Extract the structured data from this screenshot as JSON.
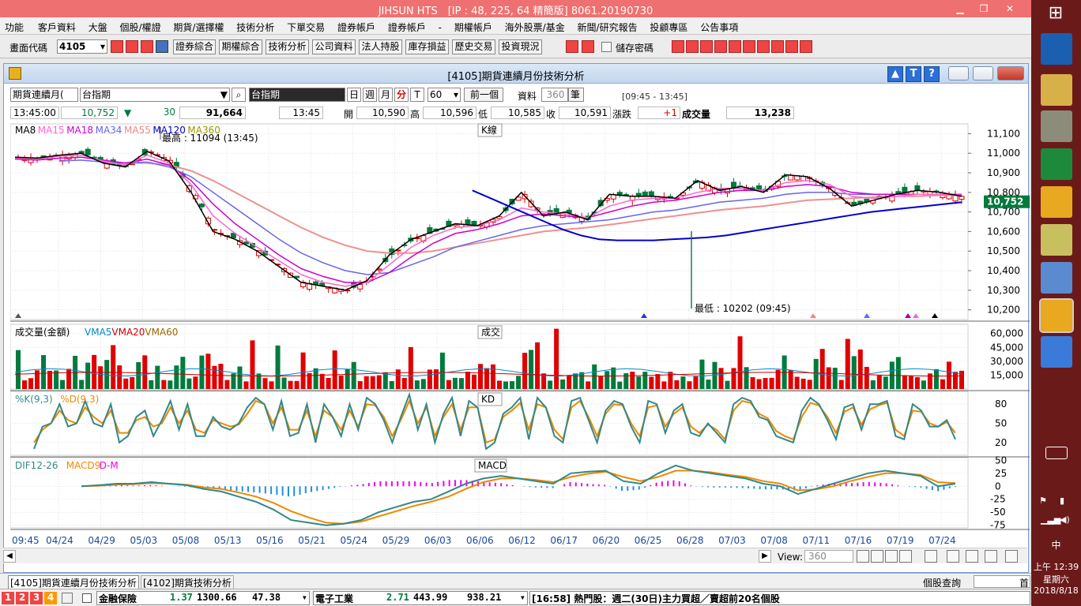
{
  "app": {
    "title": "JIHSUN HTS　[IP : 48, 225, 64 精簡版] 8061.20190730"
  },
  "menu": [
    "功能",
    "客戶資料",
    "大盤",
    "個股/權證",
    "期貨/選擇權",
    "技術分析",
    "下單交易",
    "證券帳戶",
    "證券帳戶",
    "-",
    "期權帳戶",
    "海外股票/基金",
    "新聞/研究報告",
    "投顧專區",
    "公告事項"
  ],
  "toolbar": {
    "code_label": "畫面代碼",
    "code_value": "4105",
    "buttons": [
      "證券綜合",
      "期權綜合",
      "技術分析",
      "公司資料",
      "法人持股",
      "庫存損益",
      "歷史交易",
      "投資現況"
    ],
    "save_pw": "儲存密碼"
  },
  "inner": {
    "title": "[4105]期貨連續月份技術分析"
  },
  "ctrl": {
    "product_select": "期貨連續月(",
    "product_name": "台指期",
    "index_name": "台指期",
    "periods": [
      "日",
      "週",
      "月",
      "分",
      "T"
    ],
    "period_value": "60",
    "prev_btn": "前一個",
    "data_label": "資料",
    "data_count": "360",
    "unit": "筆",
    "time_range": "[09:45 - 13:45]"
  },
  "quote": {
    "time": "13:45:00",
    "price": "10,752",
    "arrow": "▼",
    "change": "30",
    "volume_total": "91,664",
    "t2": "13:45",
    "open_l": "開",
    "open": "10,590",
    "high_l": "高",
    "high": "10,596",
    "low_l": "低",
    "low": "10,585",
    "close_l": "收",
    "close": "10,591",
    "chg_l": "漲跌",
    "chg": "+1",
    "vol_l": "成交量",
    "vol": "13,238"
  },
  "chart_data": {
    "type": "line",
    "main": {
      "legend": [
        "MA8",
        "MA15",
        "MA18",
        "MA34",
        "MA55",
        "MA120",
        "MA360"
      ],
      "legend_colors": [
        "#000000",
        "#ff66cc",
        "#cc00cc",
        "#6666ee",
        "#ee8888",
        "#0000cc",
        "#999900"
      ],
      "panel_label": "K線",
      "high_note": "最高 : 11094 (13:45)",
      "low_note": "最低 : 10202 (09:45)",
      "y_ticks": [
        "11,100",
        "11,000",
        "10,900",
        "10,800",
        "10,700",
        "10,600",
        "10,500",
        "10,400",
        "10,300",
        "10,200"
      ],
      "ylim": [
        10150,
        11150
      ],
      "last_price": "10,752",
      "ma_a": [
        10980,
        10975,
        10990,
        11000,
        10950,
        10930,
        11010,
        10960,
        10800,
        10600,
        10560,
        10500,
        10420,
        10340,
        10320,
        10300,
        10350,
        10480,
        10560,
        10600,
        10640,
        10630,
        10680,
        10800,
        10680,
        10700,
        10660,
        10790,
        10780,
        10780,
        10770,
        10860,
        10810,
        10830,
        10800,
        10890,
        10880,
        10820,
        10730,
        10760,
        10790,
        10810,
        10800,
        10780
      ],
      "ma_b": [
        10975,
        10970,
        10985,
        10990,
        10960,
        10940,
        10990,
        10950,
        10840,
        10680,
        10590,
        10520,
        10450,
        10380,
        10340,
        10320,
        10340,
        10430,
        10520,
        10580,
        10620,
        10630,
        10660,
        10720,
        10700,
        10690,
        10670,
        10730,
        10760,
        10770,
        10770,
        10800,
        10820,
        10820,
        10810,
        10850,
        10860,
        10840,
        10780,
        10770,
        10780,
        10790,
        10790,
        10785
      ],
      "ma_c": [
        10970,
        10965,
        10975,
        10980,
        10965,
        10950,
        10970,
        10940,
        10860,
        10740,
        10640,
        10560,
        10480,
        10410,
        10370,
        10340,
        10340,
        10390,
        10470,
        10540,
        10590,
        10610,
        10640,
        10680,
        10690,
        10680,
        10670,
        10700,
        10730,
        10750,
        10760,
        10780,
        10800,
        10810,
        10810,
        10830,
        10840,
        10830,
        10800,
        10790,
        10790,
        10790,
        10790,
        10788
      ],
      "ma_d": [
        null,
        null,
        10960,
        10965,
        10955,
        10950,
        10955,
        10930,
        10880,
        10800,
        10720,
        10640,
        10560,
        10490,
        10440,
        10400,
        10380,
        10390,
        10430,
        10470,
        10520,
        10550,
        10580,
        10610,
        10630,
        10640,
        10650,
        10660,
        10680,
        10700,
        10710,
        10730,
        10750,
        10760,
        10770,
        10790,
        10800,
        10800,
        10790,
        10790,
        10790,
        10790,
        10790,
        10790
      ],
      "ma_e": [
        null,
        null,
        null,
        null,
        10950,
        10950,
        10950,
        10940,
        10910,
        10860,
        10800,
        10740,
        10680,
        10620,
        10570,
        10530,
        10500,
        10490,
        10490,
        10500,
        10520,
        10540,
        10560,
        10580,
        10600,
        10610,
        10620,
        10635,
        10650,
        10665,
        10680,
        10695,
        10710,
        10720,
        10730,
        10745,
        10760,
        10765,
        10770,
        10775,
        10780,
        10780,
        10785,
        10785
      ],
      "ma_f": [
        null,
        null,
        null,
        null,
        null,
        null,
        null,
        null,
        10810,
        10770,
        10730,
        10690,
        10650,
        10610,
        10580,
        10560,
        10555,
        10555,
        10555,
        10560,
        10565,
        10570,
        10580,
        10595,
        10610,
        10625,
        10640,
        10655,
        10670,
        10685,
        10700,
        10710,
        10720,
        10730,
        10740,
        10750
      ]
    },
    "volume": {
      "legend": [
        "成交量(金額)",
        "VMA5",
        "VMA20",
        "VMA60"
      ],
      "legend_colors": [
        "#000000",
        "#0088cc",
        "#cc0000",
        "#996600"
      ],
      "panel_label": "成交",
      "y_ticks": [
        "60,000",
        "45,000",
        "30,000",
        "15,000"
      ]
    },
    "kd": {
      "legend": [
        "%K(9,3)",
        "%D(9,3)"
      ],
      "legend_colors": [
        "#338888",
        "#ee8800"
      ],
      "panel_label": "KD",
      "y_ticks": [
        "80",
        "50",
        "20"
      ],
      "k": [
        10,
        45,
        50,
        80,
        45,
        50,
        85,
        50,
        45,
        80,
        20,
        30,
        60,
        70,
        30,
        55,
        85,
        40,
        80,
        30,
        30,
        60,
        45,
        40,
        50,
        75,
        90,
        80,
        40,
        85,
        30,
        35,
        80,
        20,
        80,
        60,
        30,
        80,
        40,
        90,
        80,
        55,
        20,
        60,
        95,
        40,
        80,
        20,
        65,
        90,
        30,
        85,
        75,
        10,
        20,
        65,
        75,
        90,
        25,
        90,
        75,
        30,
        20,
        85,
        90,
        55,
        20,
        70,
        85,
        80,
        45,
        20,
        85,
        80,
        35,
        70,
        80,
        35,
        30,
        50,
        35,
        20,
        80,
        90,
        85,
        60,
        55,
        30,
        25,
        20,
        70,
        90,
        80,
        55,
        25,
        75,
        80,
        40,
        80,
        80,
        85,
        30,
        25,
        80,
        70,
        45,
        45,
        55,
        25
      ],
      "d": [
        20,
        40,
        50,
        70,
        55,
        50,
        75,
        60,
        50,
        70,
        35,
        35,
        55,
        60,
        45,
        50,
        75,
        50,
        70,
        40,
        35,
        55,
        50,
        45,
        48,
        65,
        85,
        80,
        50,
        75,
        40,
        40,
        70,
        30,
        70,
        60,
        40,
        70,
        45,
        80,
        78,
        60,
        30,
        55,
        85,
        50,
        75,
        30,
        60,
        80,
        40,
        75,
        75,
        20,
        25,
        60,
        70,
        82,
        40,
        80,
        75,
        40,
        25,
        75,
        85,
        60,
        30,
        65,
        80,
        78,
        50,
        30,
        75,
        78,
        45,
        65,
        75,
        45,
        35,
        48,
        40,
        25,
        70,
        85,
        82,
        65,
        58,
        38,
        30,
        25,
        60,
        82,
        78,
        60,
        35,
        68,
        75,
        48,
        72,
        78,
        82,
        40,
        30,
        70,
        68,
        50,
        45,
        52,
        35
      ]
    },
    "macd": {
      "legend": [
        "DIF12-26",
        "MACD9",
        "D-M"
      ],
      "legend_colors": [
        "#338888",
        "#ee8800",
        "#ee00ee"
      ],
      "panel_label": "MACD",
      "y_ticks": [
        "50",
        "25",
        "0",
        "-25",
        "-50",
        "-75"
      ],
      "ylim": [
        -80,
        55
      ],
      "dif": [
        0,
        2,
        5,
        5,
        8,
        5,
        2,
        -5,
        -10,
        -20,
        -30,
        -45,
        -65,
        -70,
        -75,
        -72,
        -65,
        -50,
        -40,
        -30,
        -25,
        -10,
        5,
        15,
        20,
        15,
        10,
        5,
        25,
        28,
        30,
        10,
        5,
        25,
        40,
        30,
        25,
        20,
        15,
        5,
        0,
        -15,
        -5,
        5,
        15,
        25,
        30,
        25,
        20,
        0,
        5
      ],
      "mac": [
        0,
        1,
        3,
        4,
        6,
        5,
        3,
        -2,
        -5,
        -12,
        -20,
        -32,
        -48,
        -60,
        -70,
        -72,
        -68,
        -58,
        -48,
        -38,
        -30,
        -20,
        -5,
        8,
        15,
        15,
        12,
        8,
        18,
        24,
        28,
        18,
        10,
        18,
        30,
        30,
        27,
        22,
        18,
        10,
        5,
        -8,
        -6,
        0,
        10,
        18,
        25,
        25,
        22,
        8,
        6
      ]
    },
    "x_ticks": [
      "09:45",
      "04/24",
      "04/29",
      "05/03",
      "05/08",
      "05/13",
      "05/16",
      "05/21",
      "05/24",
      "05/29",
      "06/03",
      "06/06",
      "06/12",
      "06/17",
      "06/20",
      "06/25",
      "06/28",
      "07/03",
      "07/08",
      "07/11",
      "07/16",
      "07/19",
      "07/24"
    ]
  },
  "scroll": {
    "view_label": "View:",
    "view_value": "360"
  },
  "tabs": [
    "[4105]期貨連續月份技術分析",
    "[4102]期貨技術分析"
  ],
  "tabs_right": "個股查詢",
  "tabs_right_btn": "首",
  "status": {
    "nums": [
      "1",
      "2",
      "3",
      "4"
    ],
    "s1_name": "金融保險",
    "s1_chg": "1.37",
    "s1_idx": "1300.66",
    "s1_vol": "47.38",
    "s2_name": "電子工業",
    "s2_chg": "2.71",
    "s2_idx": "443.99",
    "s2_vol": "938.21",
    "news": "[16:58] 熱門股：週二(30日)主力買超／賣超前20名個股"
  },
  "taskbar": {
    "time": "上午 12:39",
    "day": "星期六",
    "date": "2018/8/18",
    "ime": "中"
  },
  "colors": {
    "up": "#e00000",
    "down": "#007a3d",
    "title_bg": "#ef7070"
  }
}
